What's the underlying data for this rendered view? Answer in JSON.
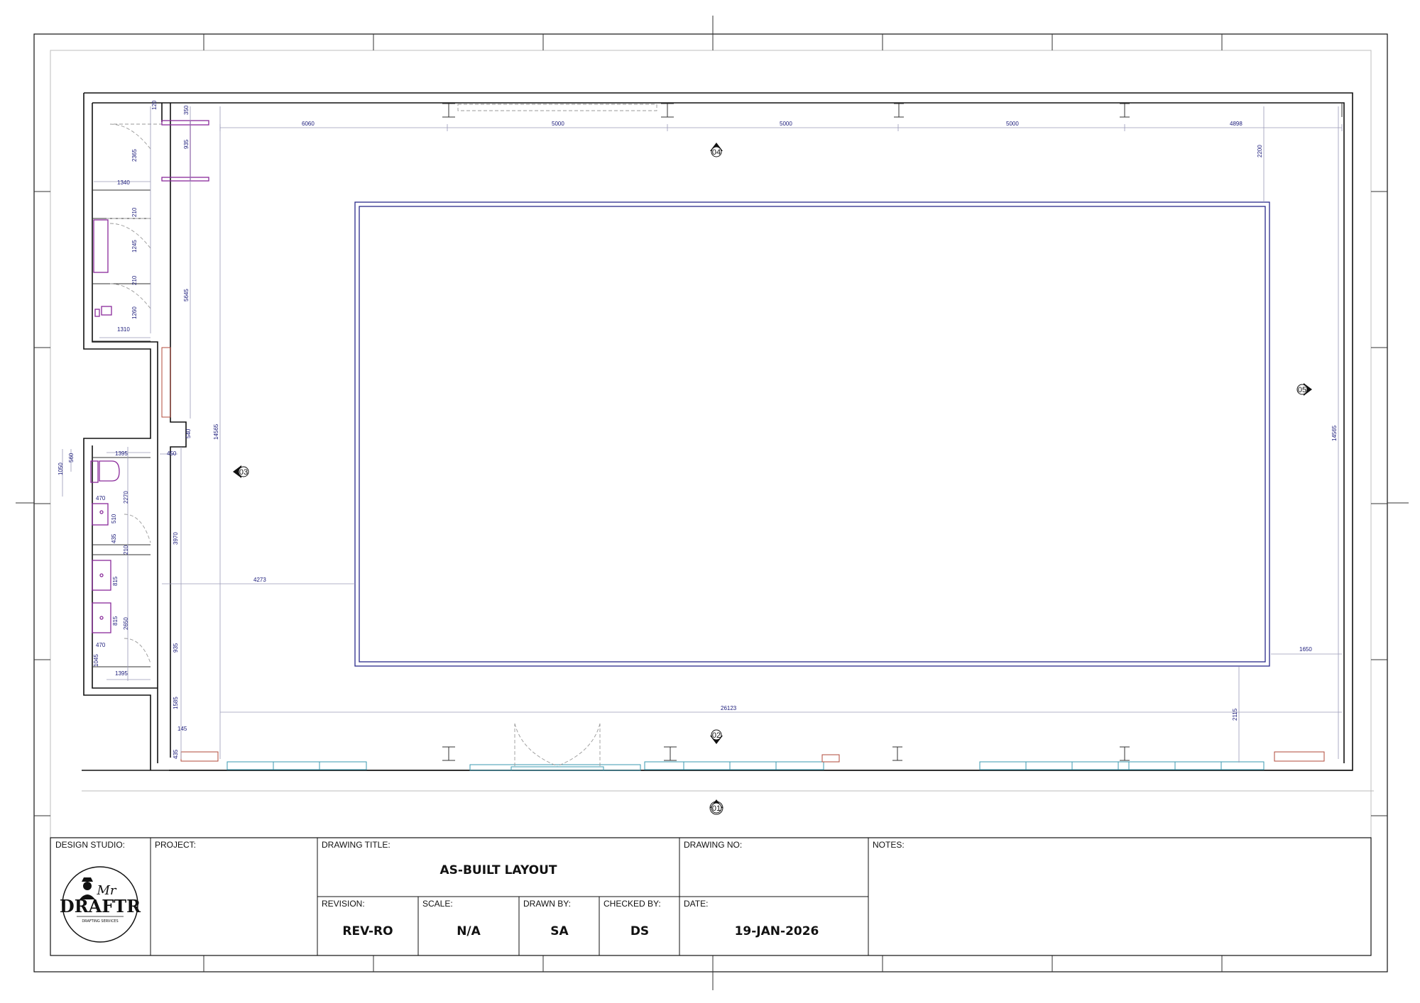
{
  "drawing": {
    "top_dims": [
      "6060",
      "5000",
      "5000",
      "5000",
      "4898"
    ],
    "right_dims": [
      "2200",
      "14565",
      "1650",
      "2115"
    ],
    "left_dims": [
      "120",
      "350",
      "935",
      "2365",
      "1340",
      "210",
      "1245",
      "210",
      "1260",
      "1310",
      "5645",
      "14565",
      "540",
      "450",
      "1395",
      "560",
      "1050",
      "470",
      "2270",
      "510",
      "435",
      "210",
      "3970",
      "815",
      "815",
      "2650",
      "470",
      "1045",
      "1395",
      "935",
      "1585",
      "145",
      "435"
    ],
    "inner_dims": [
      "4273",
      "26123"
    ],
    "markers": [
      "01",
      "02",
      "03",
      "04",
      "05"
    ]
  },
  "title_block": {
    "design_studio_label": "DESIGN STUDIO:",
    "project_label": "PROJECT:",
    "drawing_title_label": "DRAWING TITLE:",
    "drawing_title": "AS-BUILT LAYOUT",
    "drawing_no_label": "DRAWING NO:",
    "notes_label": "NOTES:",
    "revision_label": "REVISION:",
    "revision": "REV-RO",
    "scale_label": "SCALE:",
    "scale": "N/A",
    "drawn_by_label": "DRAWN BY:",
    "drawn_by": "SA",
    "checked_by_label": "CHECKED BY:",
    "checked_by": "DS",
    "date_label": "DATE:",
    "date": "19-JAN-2026",
    "logo": {
      "mr": "Mr",
      "name": "DRAFTR",
      "tagline": "DRAFTING SERVICES"
    }
  }
}
